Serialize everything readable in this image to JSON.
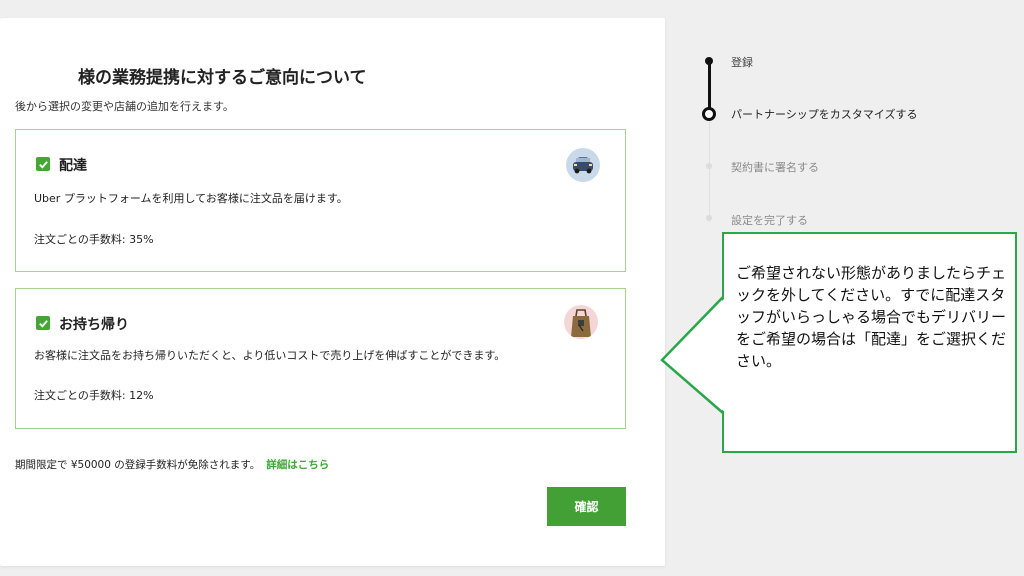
{
  "page": {
    "title": "様の業務提携に対するご意向について",
    "subtitle": "後から選択の変更や店舗の追加を行えます。"
  },
  "options": [
    {
      "name": "配達",
      "checked": true,
      "description": "Uber プラットフォームを利用してお客様に注文品を届けます。",
      "fee": "注文ごとの手数料: 35%",
      "icon": "car-icon"
    },
    {
      "name": "お持ち帰り",
      "checked": true,
      "description": "お客様に注文品をお持ち帰りいただくと、より低いコストで売り上げを伸ばすことができます。",
      "fee": "注文ごとの手数料: 12%",
      "icon": "takeout-bag-icon"
    }
  ],
  "promo": {
    "text": "期間限定で ¥50000 の登録手数料が免除されます。",
    "link": "詳細はこちら"
  },
  "confirm_label": "確認",
  "steps": [
    {
      "label": "登録",
      "state": "done"
    },
    {
      "label": "パートナーシップをカスタマイズする",
      "state": "current"
    },
    {
      "label": "契約書に署名する",
      "state": "upcoming"
    },
    {
      "label": "設定を完了する",
      "state": "upcoming"
    }
  ],
  "callout": {
    "text": "ご希望されない形態がありましたらチェックを外してください。すでに配達スタッフがいらっしゃる場合でもデリバリーをご希望の場合は「配達」をご選択ください。"
  },
  "colors": {
    "accent": "#43a035",
    "option_border": "#a6d28f",
    "callout_border": "#28a84a",
    "link": "#3fa634"
  }
}
